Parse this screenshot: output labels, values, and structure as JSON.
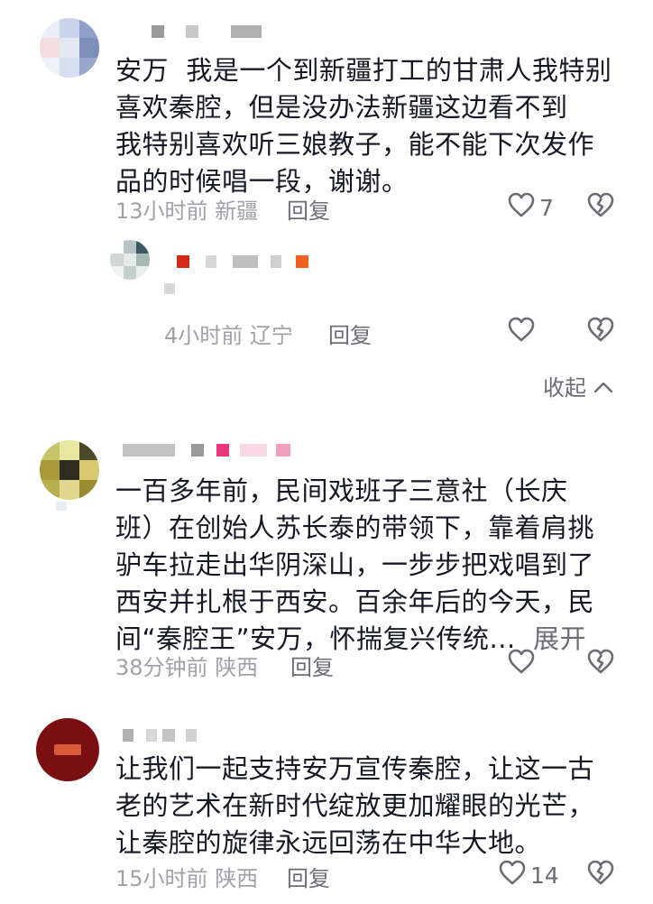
{
  "comments": [
    {
      "text": "安万  我是一个到新疆打工的甘肃人我特别\n喜欢秦腔，但是没办法新疆这边看不到\n我特别喜欢听三娘教子，能不能下次发作\n品的时候唱一段，谢谢。",
      "time": "13小时前",
      "location": "新疆",
      "reply_label": "回复",
      "likes": "7"
    },
    {
      "text": "一百多年前，民间戏班子三意社（长庆\n班）在创始人苏长泰的带领下，靠着肩挑\n驴车拉走出华阴深山，一步步把戏唱到了\n西安并扎根于西安。百余年后的今天，民\n间“秦腔王”安万，怀揣复兴传统...",
      "expand_label": "展开",
      "time": "38分钟前",
      "location": "陕西",
      "reply_label": "回复",
      "likes": ""
    },
    {
      "text": "让我们一起支持安万宣传秦腔，让这一古\n老的艺术在新时代绽放更加耀眼的光芒，\n让秦腔的旋律永远回荡在中华大地。",
      "time": "15小时前",
      "location": "陕西",
      "reply_label": "回复",
      "likes": "14"
    }
  ],
  "reply": {
    "time": "4小时前",
    "location": "辽宁",
    "reply_label": "回复",
    "likes": ""
  },
  "collapse_label": "收起",
  "icons": {
    "like": "heart-outline-icon",
    "dislike": "broken-heart-icon",
    "collapse": "chevron-up-icon"
  },
  "colors": {
    "text": "#161823",
    "meta": "#a0a2a7",
    "action": "#6b6d74"
  }
}
